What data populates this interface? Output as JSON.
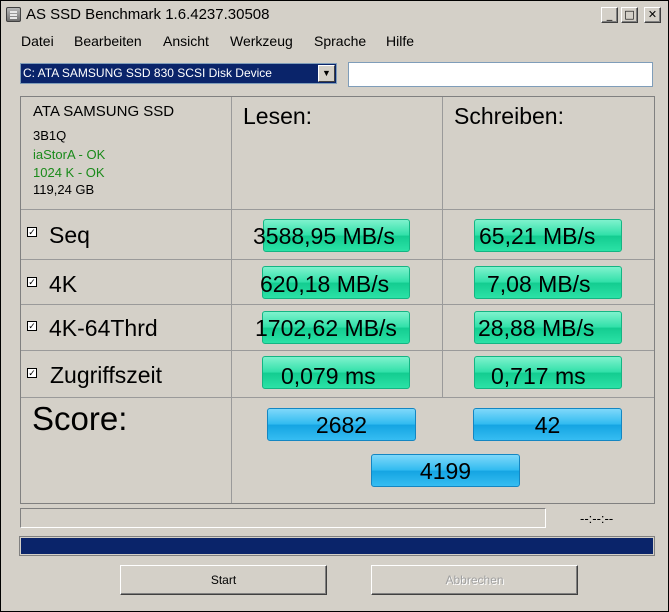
{
  "window": {
    "title": "AS SSD Benchmark 1.6.4237.30508",
    "controls": {
      "minimize": "_",
      "maximize": "□",
      "close": "✕"
    }
  },
  "menu": [
    "Datei",
    "Bearbeiten",
    "Ansicht",
    "Werkzeug",
    "Sprache",
    "Hilfe"
  ],
  "drive": {
    "selected": "C: ATA SAMSUNG SSD 830 SCSI Disk Device",
    "dropdown_icon": "chevron-down-icon",
    "name_value": ""
  },
  "info": {
    "name": "ATA SAMSUNG SSD",
    "firmware": "3B1Q",
    "driver": "iaStorA - OK",
    "alignment": "1024 K - OK",
    "size": "119,24 GB",
    "ok_color": "#1a8a1a"
  },
  "headers": {
    "read": "Lesen:",
    "write": "Schreiben:"
  },
  "rows": [
    {
      "checked": "✓",
      "label": "Seq",
      "read": "3588,95 MB/s",
      "write": "65,21 MB/s"
    },
    {
      "checked": "✓",
      "label": "4K",
      "read": "620,18 MB/s",
      "write": "7,08 MB/s"
    },
    {
      "checked": "✓",
      "label": "4K-64Thrd",
      "read": "1702,62 MB/s",
      "write": "28,88 MB/s"
    },
    {
      "checked": "✓",
      "label": "Zugriffszeit",
      "read": "0,079 ms",
      "write": "0,717 ms"
    }
  ],
  "score": {
    "label": "Score:",
    "read": "2682",
    "write": "42",
    "total": "4199"
  },
  "status": {
    "time": "--:--:--",
    "main_progress_percent": 100
  },
  "buttons": {
    "start": "Start",
    "cancel": "Abbrechen"
  },
  "colors": {
    "result_green": "#2fe0a8",
    "score_blue": "#2fbaf0",
    "progress_fill": "#0a246a"
  }
}
